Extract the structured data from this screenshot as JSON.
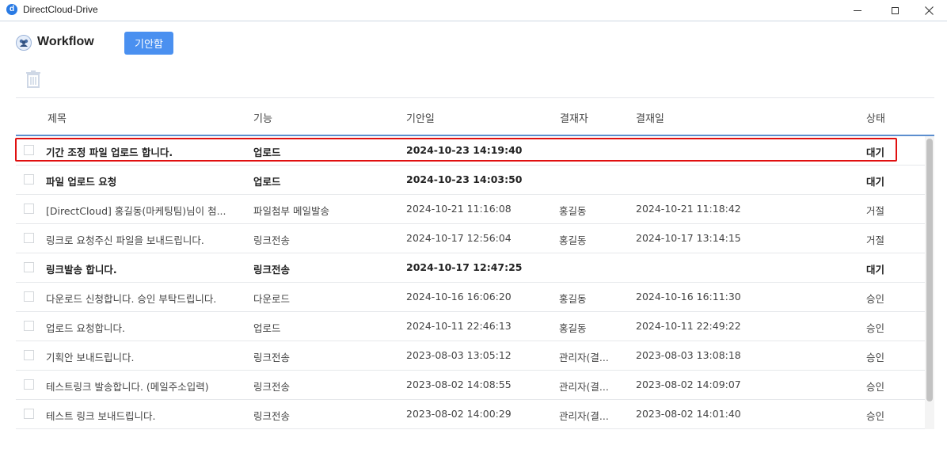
{
  "window": {
    "title": "DirectCloud-Drive",
    "logo_letter": "d"
  },
  "header": {
    "title": "Workflow",
    "draft_button": "기안함"
  },
  "table": {
    "columns": {
      "title": "제목",
      "function": "기능",
      "draft_date": "기안일",
      "approver": "결재자",
      "approval_date": "결재일",
      "status": "상태"
    },
    "rows": [
      {
        "title": "기간 조정 파일 업로드 합니다.",
        "function": "업로드",
        "draft_date": "2024-10-23 14:19:40",
        "approver": "",
        "approval_date": "",
        "status": "대기"
      },
      {
        "title": "파일 업로드 요청",
        "function": "업로드",
        "draft_date": "2024-10-23 14:03:50",
        "approver": "",
        "approval_date": "",
        "status": "대기"
      },
      {
        "title": "[DirectCloud] 홍길동(마케팅팀)님이 첨...",
        "function": "파일첨부 메일발송",
        "draft_date": "2024-10-21 11:16:08",
        "approver": "홍길동",
        "approval_date": "2024-10-21 11:18:42",
        "status": "거절"
      },
      {
        "title": "링크로 요청주신 파일을 보내드립니다.",
        "function": "링크전송",
        "draft_date": "2024-10-17 12:56:04",
        "approver": "홍길동",
        "approval_date": "2024-10-17 13:14:15",
        "status": "거절"
      },
      {
        "title": "링크발송 합니다.",
        "function": "링크전송",
        "draft_date": "2024-10-17 12:47:25",
        "approver": "",
        "approval_date": "",
        "status": "대기"
      },
      {
        "title": "다운로드 신청합니다. 승인 부탁드립니다.",
        "function": "다운로드",
        "draft_date": "2024-10-16 16:06:20",
        "approver": "홍길동",
        "approval_date": "2024-10-16 16:11:30",
        "status": "승인"
      },
      {
        "title": "업로드 요청합니다.",
        "function": "업로드",
        "draft_date": "2024-10-11 22:46:13",
        "approver": "홍길동",
        "approval_date": "2024-10-11 22:49:22",
        "status": "승인"
      },
      {
        "title": "기획안 보내드립니다.",
        "function": "링크전송",
        "draft_date": "2023-08-03 13:05:12",
        "approver": "관리자(결...",
        "approval_date": "2023-08-03 13:08:18",
        "status": "승인"
      },
      {
        "title": "테스트링크 발송합니다. (메일주소입력)",
        "function": "링크전송",
        "draft_date": "2023-08-02 14:08:55",
        "approver": "관리자(결...",
        "approval_date": "2023-08-02 14:09:07",
        "status": "승인"
      },
      {
        "title": "테스트 링크 보내드립니다.",
        "function": "링크전송",
        "draft_date": "2023-08-02 14:00:29",
        "approver": "관리자(결...",
        "approval_date": "2023-08-02 14:01:40",
        "status": "승인"
      }
    ]
  },
  "colors": {
    "accent": "#4a90f0",
    "highlight": "#e01010",
    "header_line": "#5c8ecf"
  }
}
